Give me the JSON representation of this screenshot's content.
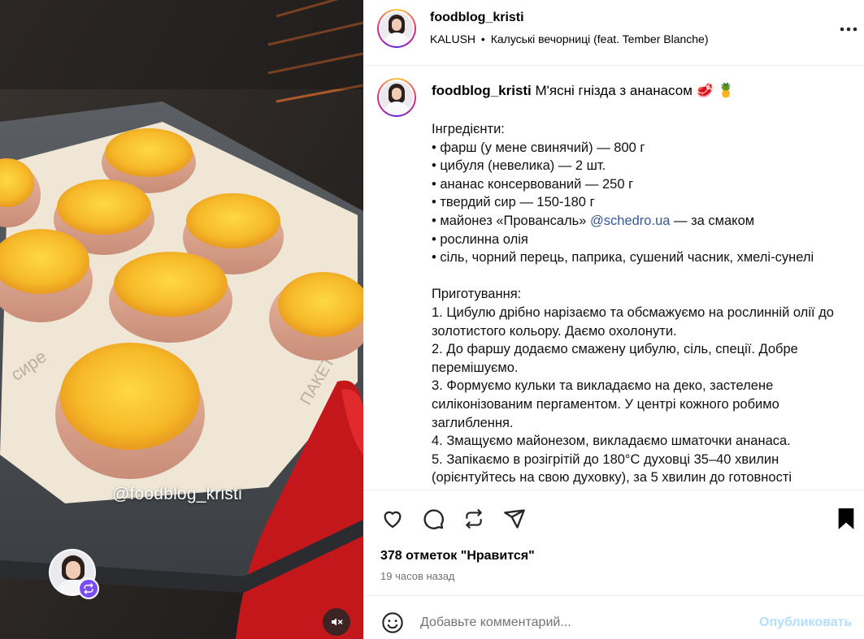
{
  "media": {
    "watermark": "@foodblog_kristi",
    "icons": {
      "repost": "repost-icon",
      "mute": "sound-off-icon"
    }
  },
  "header": {
    "username": "foodblog_kristi",
    "audio_artist": "KALUSH",
    "audio_separator": "•",
    "audio_track": "Калуські вечорниці (feat. Tember Blanche)",
    "more_icon": "more-options-icon"
  },
  "caption": {
    "username": "foodblog_kristi",
    "title": "М'ясні гнізда з ананасом 🥩 🍍",
    "ingredients_heading": "Інгредієнти:",
    "ingredients": [
      "• фарш (у мене свинячий) — 800 г",
      "• цибуля (невелика) — 2 шт.",
      "• ананас консервований — 250 г",
      "• твердий сир — 150-180 г"
    ],
    "mayo_prefix": "• майонез «Провансаль» ",
    "mayo_mention": "@schedro.ua",
    "mayo_suffix": " — за смаком",
    "ingredients_rest": [
      "• рослинна олія",
      "• сіль, чорний перець, паприка, сушений часник, хмелі-сунелі"
    ],
    "method_heading": "Приготування:",
    "steps": [
      "1. Цибулю дрібно нарізаємо та обсмажуємо на рослинній олії до золотистого кольору. Даємо охолонути.",
      "2. До фаршу додаємо смажену цибулю, сіль, спеції. Добре перемішуємо.",
      "3. Формуємо кульки та викладаємо на деко, застелене силіконізованим пергаментом. У центрі кожного робимо заглиблення.",
      "4. Змащуємо майонезом, викладаємо шматочки ананаса.",
      "5. Запікаємо в розігрітій до 180°C духовці 35–40 хвилин (орієнтуйтесь на свою духовку), за 5 хвилин до готовності"
    ]
  },
  "actions": {
    "icons": [
      "heart-icon",
      "comment-icon",
      "repost-icon",
      "share-icon",
      "bookmark-icon"
    ],
    "likes": "378 отметок \"Нравится\"",
    "time": "19 часов назад"
  },
  "comment": {
    "placeholder": "Добавьте комментарий...",
    "post_label": "Опубликовать",
    "emoji_icon": "emoji-icon"
  },
  "colors": {
    "mention": "#385898",
    "post_button": "#b2dffc",
    "secondary_text": "#737373",
    "repost_badge": "#7a4cf5"
  }
}
